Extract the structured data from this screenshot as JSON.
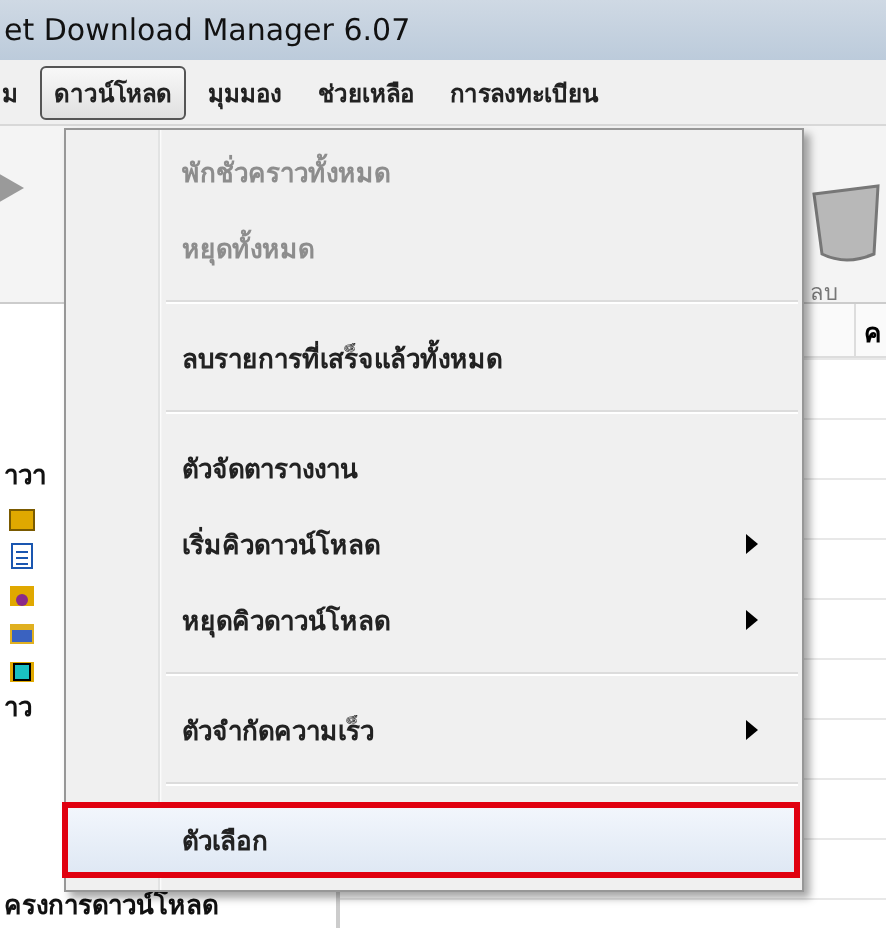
{
  "window": {
    "title": "et Download Manager 6.07"
  },
  "menubar": [
    {
      "label": "ม",
      "selected": false
    },
    {
      "label": "ดาวน์โหลด",
      "selected": true
    },
    {
      "label": "มุมมอง",
      "selected": false
    },
    {
      "label": "ช่วยเหลือ",
      "selected": false
    },
    {
      "label": "การลงทะเบียน",
      "selected": false
    }
  ],
  "toolbar": {
    "delete_label": "ลบ"
  },
  "table": {
    "columns": [
      "ค"
    ]
  },
  "sidebar": {
    "items": [
      {
        "label": "าวา"
      },
      {
        "label": "าว"
      },
      {
        "label": "ครงการดาวน์โหลด"
      }
    ]
  },
  "menu": {
    "items": [
      {
        "kind": "item",
        "label": "พักชั่วคราวทั้งหมด",
        "disabled": true,
        "submenu": false,
        "highlighted": false
      },
      {
        "kind": "item",
        "label": "หยุดทั้งหมด",
        "disabled": true,
        "submenu": false,
        "highlighted": false
      },
      {
        "kind": "separator"
      },
      {
        "kind": "item",
        "label": "ลบรายการที่เสร็จแล้วทั้งหมด",
        "disabled": false,
        "submenu": false,
        "highlighted": false
      },
      {
        "kind": "separator"
      },
      {
        "kind": "item",
        "label": "ตัวจัดตารางงาน",
        "disabled": false,
        "submenu": false,
        "highlighted": false
      },
      {
        "kind": "item",
        "label": "เริ่มคิวดาวน์โหลด",
        "disabled": false,
        "submenu": true,
        "highlighted": false
      },
      {
        "kind": "item",
        "label": "หยุดคิวดาวน์โหลด",
        "disabled": false,
        "submenu": true,
        "highlighted": false
      },
      {
        "kind": "separator"
      },
      {
        "kind": "item",
        "label": "ตัวจำกัดความเร็ว",
        "disabled": false,
        "submenu": true,
        "highlighted": false
      },
      {
        "kind": "separator"
      },
      {
        "kind": "item",
        "label": "ตัวเลือก",
        "disabled": false,
        "submenu": false,
        "highlighted": true
      }
    ]
  }
}
